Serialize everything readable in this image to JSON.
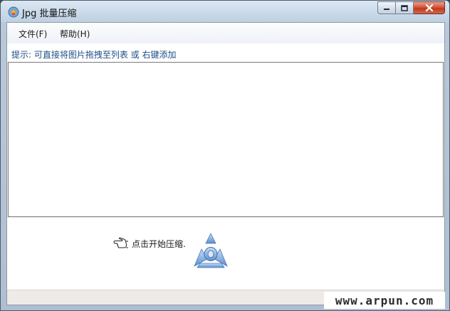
{
  "window": {
    "title": "Jpg 批量压缩",
    "controls": {
      "minimize": "minimize-icon",
      "maximize": "maximize-icon",
      "close": "close-icon"
    }
  },
  "menu": {
    "items": [
      {
        "label": "文件(F)"
      },
      {
        "label": "帮助(H)"
      }
    ]
  },
  "hint": {
    "text": "提示: 可直接将图片拖拽至列表 或 右键添加"
  },
  "file_list": {
    "items": []
  },
  "actions": {
    "start_label": "点击开始压缩.",
    "start_icon": "pointing-hand-icon",
    "logo_icon": "triangle-logo-icon"
  },
  "watermark": {
    "text": "www.arpun.com"
  },
  "colors": {
    "hint_text": "#1f4d87",
    "logo_blue": "#6f9fd8",
    "close_red": "#c0381f"
  }
}
